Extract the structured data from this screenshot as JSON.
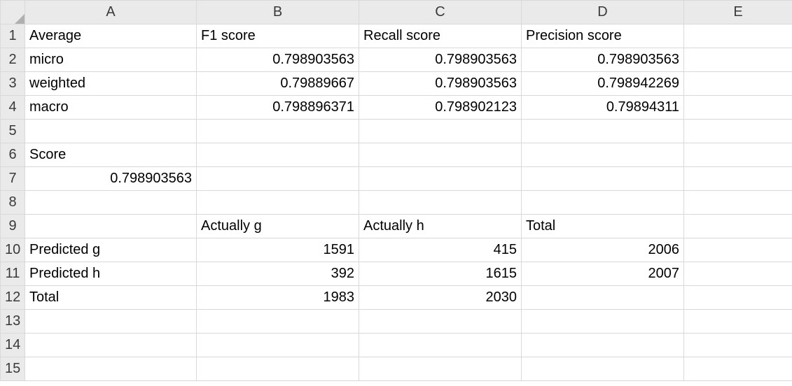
{
  "columns": [
    "A",
    "B",
    "C",
    "D",
    "E"
  ],
  "rows": [
    "1",
    "2",
    "3",
    "4",
    "5",
    "6",
    "7",
    "8",
    "9",
    "10",
    "11",
    "12",
    "13",
    "14",
    "15"
  ],
  "cells": {
    "A1": {
      "v": "Average",
      "t": "txt"
    },
    "B1": {
      "v": "F1 score",
      "t": "txt"
    },
    "C1": {
      "v": "Recall score",
      "t": "txt"
    },
    "D1": {
      "v": "Precision score",
      "t": "txt"
    },
    "A2": {
      "v": "micro",
      "t": "txt"
    },
    "B2": {
      "v": "0.798903563",
      "t": "num"
    },
    "C2": {
      "v": "0.798903563",
      "t": "num"
    },
    "D2": {
      "v": "0.798903563",
      "t": "num"
    },
    "A3": {
      "v": "weighted",
      "t": "txt"
    },
    "B3": {
      "v": "0.79889667",
      "t": "num"
    },
    "C3": {
      "v": "0.798903563",
      "t": "num"
    },
    "D3": {
      "v": "0.798942269",
      "t": "num"
    },
    "A4": {
      "v": "macro",
      "t": "txt"
    },
    "B4": {
      "v": "0.798896371",
      "t": "num"
    },
    "C4": {
      "v": "0.798902123",
      "t": "num"
    },
    "D4": {
      "v": "0.79894311",
      "t": "num"
    },
    "A6": {
      "v": "Score",
      "t": "txt"
    },
    "A7": {
      "v": "0.798903563",
      "t": "num"
    },
    "B9": {
      "v": "Actually g",
      "t": "txt"
    },
    "C9": {
      "v": "Actually h",
      "t": "txt"
    },
    "D9": {
      "v": "Total",
      "t": "txt"
    },
    "A10": {
      "v": "Predicted g",
      "t": "txt"
    },
    "B10": {
      "v": "1591",
      "t": "num"
    },
    "C10": {
      "v": "415",
      "t": "num"
    },
    "D10": {
      "v": "2006",
      "t": "num"
    },
    "A11": {
      "v": "Predicted h",
      "t": "txt"
    },
    "B11": {
      "v": "392",
      "t": "num"
    },
    "C11": {
      "v": "1615",
      "t": "num"
    },
    "D11": {
      "v": "2007",
      "t": "num"
    },
    "A12": {
      "v": "Total",
      "t": "txt"
    },
    "B12": {
      "v": "1983",
      "t": "num"
    },
    "C12": {
      "v": "2030",
      "t": "num"
    }
  },
  "chart_data": [
    {
      "type": "table",
      "title": "Average scores",
      "columns": [
        "Average",
        "F1 score",
        "Recall score",
        "Precision score"
      ],
      "rows": [
        [
          "micro",
          0.798903563,
          0.798903563,
          0.798903563
        ],
        [
          "weighted",
          0.79889667,
          0.798903563,
          0.798942269
        ],
        [
          "macro",
          0.798896371,
          0.798902123,
          0.79894311
        ]
      ]
    },
    {
      "type": "table",
      "title": "Score",
      "columns": [
        "Score"
      ],
      "rows": [
        [
          0.798903563
        ]
      ]
    },
    {
      "type": "table",
      "title": "Confusion matrix",
      "columns": [
        "",
        "Actually g",
        "Actually h",
        "Total"
      ],
      "rows": [
        [
          "Predicted g",
          1591,
          415,
          2006
        ],
        [
          "Predicted h",
          392,
          1615,
          2007
        ],
        [
          "Total",
          1983,
          2030,
          null
        ]
      ]
    }
  ]
}
